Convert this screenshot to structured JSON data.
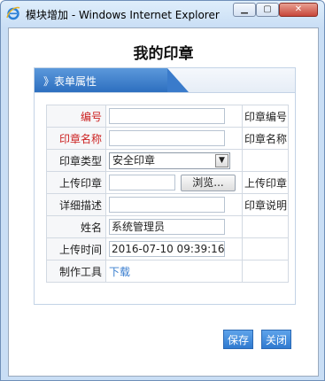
{
  "window": {
    "title": "模块增加 - Windows Internet Explorer",
    "min_glyph": "▁",
    "max_glyph": "▢",
    "close_glyph": "✕"
  },
  "page": {
    "title": "我的印章",
    "panel_tab": "》表单属性"
  },
  "form": {
    "rows": [
      {
        "label": "编号",
        "value": "",
        "note": "印章编号"
      },
      {
        "label": "印章名称",
        "value": "",
        "note": "印章名称"
      },
      {
        "label": "印章类型",
        "value": "安全印章",
        "note": ""
      },
      {
        "label": "上传印章",
        "value": "",
        "button": "浏览...",
        "note": "上传印章"
      },
      {
        "label": "详细描述",
        "value": "",
        "note": "印章说明"
      },
      {
        "label": "姓名",
        "value": "系统管理员",
        "note": ""
      },
      {
        "label": "上传时间",
        "value": "2016-07-10 09:39:16",
        "note": ""
      },
      {
        "label": "制作工具",
        "link": "下载",
        "note": ""
      }
    ]
  },
  "buttons": {
    "save": "保存",
    "close": "关闭"
  },
  "colors": {
    "accent": "#2f7ad0",
    "required_label": "#cc1f1f",
    "link": "#3a7ecf"
  }
}
